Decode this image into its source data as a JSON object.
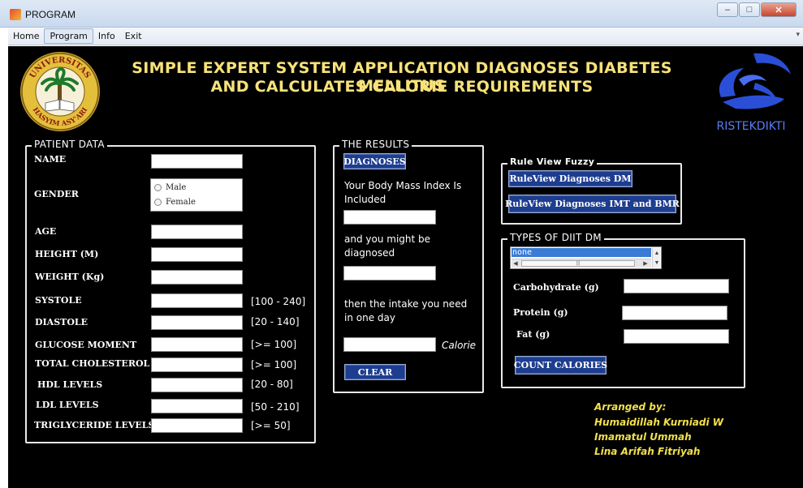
{
  "window": {
    "title": "PROGRAM",
    "minimize": "–",
    "maximize": "□",
    "close": "✕"
  },
  "menu": {
    "items": [
      "Home",
      "Program",
      "Info",
      "Exit"
    ],
    "chevron": "▾"
  },
  "header": {
    "line1": "SIMPLE EXPERT SYSTEM APPLICATION DIAGNOSES DIABETES MELLITUS",
    "line2": "AND CALCULATES CALORIE REQUIREMENTS"
  },
  "logos": {
    "left": {
      "top_text": "UNIVERSITAS",
      "bottom_text": "HASYIM ASY'ARI"
    },
    "right": {
      "text": "RISTEKDIKTI"
    }
  },
  "patient": {
    "title": "PATIENT DATA",
    "name_label": "NAME",
    "gender_label": "GENDER",
    "gender_options": [
      "Male",
      "Female"
    ],
    "age_label": "AGE",
    "height_label": "HEIGHT (M)",
    "weight_label": "WEIGHT (Kg)",
    "systole_label": "SYSTOLE",
    "systole_range": "[100 - 240]",
    "diastole_label": "DIASTOLE",
    "diastole_range": "[20 - 140]",
    "glucose_label": "GLUCOSE MOMENT",
    "glucose_range": "[>= 100]",
    "cholesterol_label": "TOTAL CHOLESTEROL",
    "cholesterol_range": "[>= 100]",
    "hdl_label": "HDL LEVELS",
    "hdl_range": "[20 - 80]",
    "ldl_label": "LDL LEVELS",
    "ldl_range": "[50 - 210]",
    "trig_label": "TRIGLYCERIDE LEVELS",
    "trig_range": "[>= 50]"
  },
  "results": {
    "title": "THE RESULTS",
    "diagnoses_button": "DIAGNOSES",
    "bmi_text_1": "Your Body Mass Index Is",
    "bmi_text_2": "Included",
    "diag_text_1": "and you might be",
    "diag_text_2": "diagnosed",
    "intake_text_1": "then the intake you need",
    "intake_text_2": "in one day",
    "calorie_unit": "Calorie",
    "clear_button": "CLEAR"
  },
  "rule_view": {
    "title": "Rule View Fuzzy",
    "dm_button": "RuleView Diagnoses DM",
    "imt_button": "RuleView Diagnoses IMT and BMR"
  },
  "diet": {
    "title": "TYPES OF DIIT DM",
    "selected_option": "none",
    "carbohydrate_label": "Carbohydrate (g)",
    "protein_label": "Protein (g)",
    "fat_label": "Fat (g)",
    "count_button": "COUNT CALORIES"
  },
  "credits": {
    "heading": "Arranged by:",
    "authors": [
      "Humaidillah Kurniadi W",
      "Imamatul Ummah",
      "Lina Arifah Fitriyah"
    ]
  }
}
